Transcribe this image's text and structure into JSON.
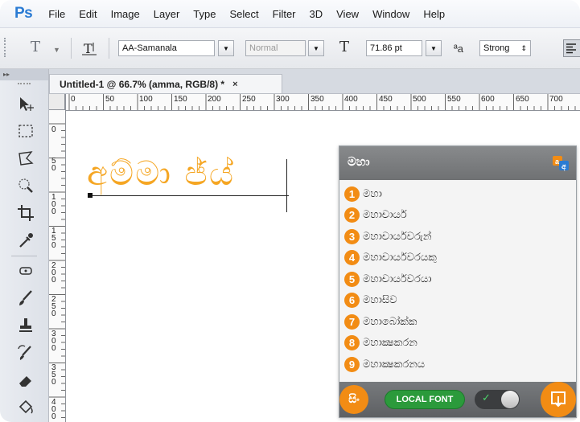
{
  "app": {
    "logo": "Ps",
    "menu": [
      "File",
      "Edit",
      "Image",
      "Layer",
      "Type",
      "Select",
      "Filter",
      "3D",
      "View",
      "Window",
      "Help"
    ]
  },
  "options_bar": {
    "font_family": "AA-Samanala",
    "font_style": "Normal",
    "font_size": "71.86 pt",
    "antialias": "Strong",
    "antialias_glyph": "ªa"
  },
  "document": {
    "tab_title": "Untitled-1 @ 66.7% (amma, RGB/8) *",
    "close_glyph": "×",
    "typed_text": "අම්මා ජ්ය්",
    "text_color": "#f5a623"
  },
  "rulers": {
    "horizontal": [
      "0",
      "50",
      "100",
      "150",
      "200",
      "250",
      "300",
      "350",
      "400",
      "450",
      "500",
      "550",
      "600",
      "650",
      "700"
    ],
    "vertical": [
      "0",
      "50",
      "100",
      "150",
      "200",
      "250",
      "300",
      "350",
      "400"
    ]
  },
  "suggestions": {
    "input_word": "මහා",
    "items": [
      {
        "num": "1",
        "text": "මහා"
      },
      {
        "num": "2",
        "text": "මහාචාර්ය"
      },
      {
        "num": "3",
        "text": "මහාචාර්යවරුන්"
      },
      {
        "num": "4",
        "text": "මහාචාර්යවරයකු"
      },
      {
        "num": "5",
        "text": "මහාචාර්යවරයා"
      },
      {
        "num": "6",
        "text": "මහාසිව"
      },
      {
        "num": "7",
        "text": "මහාබෝක්ක"
      },
      {
        "num": "8",
        "text": "මහාක්‍ෂකරන"
      },
      {
        "num": "9",
        "text": "මහාක්‍ෂකරනය"
      }
    ],
    "lang_button": "සිං",
    "local_font_label": "LOCAL FONT",
    "toggle_check": "✓",
    "accent_color": "#f28c14"
  }
}
